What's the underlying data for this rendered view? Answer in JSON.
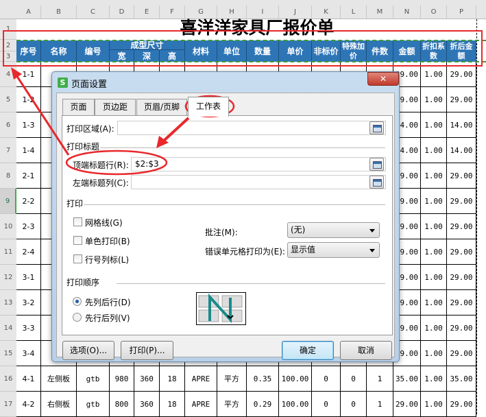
{
  "sheet": {
    "columns": [
      "A",
      "B",
      "C",
      "D",
      "E",
      "F",
      "G",
      "H",
      "I",
      "J",
      "K",
      "L",
      "M",
      "N",
      "O",
      "P"
    ],
    "row_numbers": [
      "1",
      "2",
      "3",
      "4",
      "5",
      "6",
      "7",
      "8",
      "9",
      "10",
      "11",
      "12",
      "13",
      "14",
      "15",
      "16",
      "17"
    ],
    "title": "喜洋洋家具厂报价单",
    "headers": {
      "seq": "序号",
      "name": "名称",
      "code": "编号",
      "size": "成型尺寸",
      "w": "宽",
      "d": "深",
      "h": "高",
      "material": "材料",
      "unit": "单位",
      "qty": "数量",
      "price": "单价",
      "nonstd": "非标价",
      "special": "特殊加价",
      "pieces": "件数",
      "amount": "金额",
      "discount": "折扣系数",
      "final": "折后金额"
    },
    "rows": [
      {
        "seq": "1-1",
        "n": "29.00",
        "o": "1.00",
        "p": "29.00"
      },
      {
        "seq": "1-2",
        "n": "29.00",
        "o": "1.00",
        "p": "29.00"
      },
      {
        "seq": "1-3",
        "n": "14.00",
        "o": "1.00",
        "p": "14.00"
      },
      {
        "seq": "1-4",
        "n": "14.00",
        "o": "1.00",
        "p": "14.00"
      },
      {
        "seq": "2-1",
        "n": "29.00",
        "o": "1.00",
        "p": "29.00"
      },
      {
        "seq": "2-2",
        "n": "29.00",
        "o": "1.00",
        "p": "29.00"
      },
      {
        "seq": "2-3",
        "n": "29.00",
        "o": "1.00",
        "p": "29.00"
      },
      {
        "seq": "2-4",
        "n": "29.00",
        "o": "1.00",
        "p": "29.00"
      },
      {
        "seq": "3-1",
        "n": "29.00",
        "o": "1.00",
        "p": "29.00"
      },
      {
        "seq": "3-2",
        "n": "29.00",
        "o": "1.00",
        "p": "29.00"
      },
      {
        "seq": "3-3",
        "n": "29.00",
        "o": "1.00",
        "p": "29.00"
      },
      {
        "seq": "3-4",
        "n": "29.00",
        "o": "1.00",
        "p": "29.00"
      }
    ],
    "full_rows": [
      [
        "4-1",
        "左侧板",
        "gtb",
        "980",
        "360",
        "18",
        "APRE",
        "平方",
        "0.35",
        "100.00",
        "0",
        "0",
        "1",
        "35.00",
        "1.00",
        "35.00"
      ],
      [
        "4-2",
        "右侧板",
        "gtb",
        "800",
        "360",
        "18",
        "APRE",
        "平方",
        "0.29",
        "100.00",
        "0",
        "0",
        "1",
        "29.00",
        "1.00",
        "29.00"
      ]
    ]
  },
  "dialog": {
    "title": "页面设置",
    "tabs": [
      "页面",
      "页边距",
      "页眉/页脚",
      "工作表"
    ],
    "active_tab": "工作表",
    "print_area_label": "打印区域(A):",
    "print_area_value": "",
    "print_titles_section": "打印标题",
    "top_rows_label": "顶端标题行(R):",
    "top_rows_value": "$2:$3",
    "left_cols_label": "左端标题列(C):",
    "left_cols_value": "",
    "print_section": "打印",
    "gridlines": "网格线(G)",
    "mono": "单色打印(B)",
    "rowcol": "行号列标(L)",
    "comments_label": "批注(M):",
    "comments_value": "(无)",
    "errors_label": "错误单元格打印为(E):",
    "errors_value": "显示值",
    "order_section": "打印顺序",
    "down_then_over": "先列后行(D)",
    "over_then_down": "先行后列(V)",
    "options_btn": "选项(O)...",
    "print_btn": "打印(P)...",
    "ok_btn": "确定",
    "cancel_btn": "取消"
  },
  "colors": {
    "header_fill": "#2e75b6",
    "annotation": "#e8282b",
    "app_icon": "#3fae49"
  }
}
